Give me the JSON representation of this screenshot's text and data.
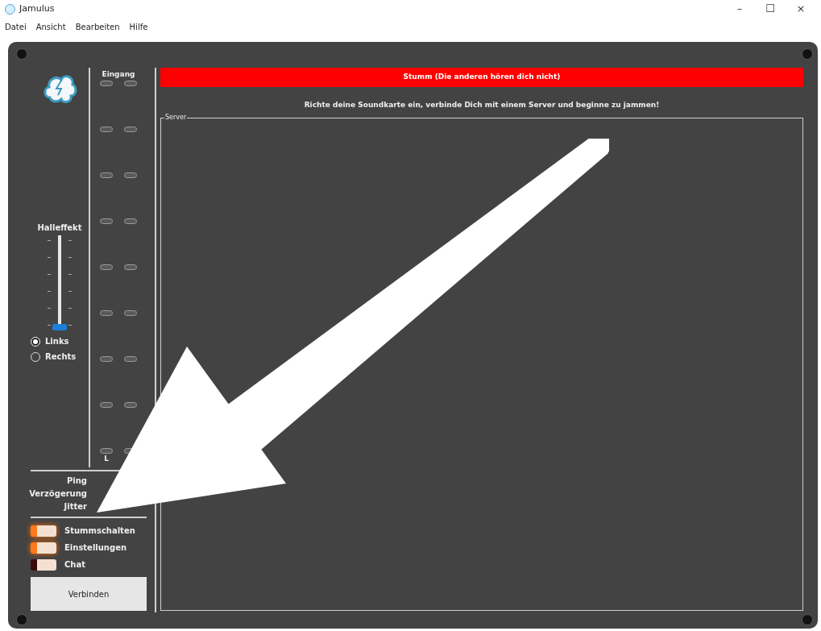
{
  "window": {
    "title": "Jamulus",
    "controls": [
      "–",
      "☐",
      "×"
    ]
  },
  "menu": [
    "Datei",
    "Ansicht",
    "Bearbeiten",
    "Hilfe"
  ],
  "reverb": {
    "label": "Halleffekt",
    "level": 0,
    "channels": [
      {
        "label": "Links",
        "selected": true
      },
      {
        "label": "Rechts",
        "selected": false
      }
    ]
  },
  "input_meter": {
    "title": "Eingang",
    "channel_label": "L"
  },
  "stats": [
    {
      "label": "Ping"
    },
    {
      "label": "Verzögerung"
    },
    {
      "label": "Jitter"
    }
  ],
  "toggles": [
    {
      "label": "Stummschalten",
      "on": true
    },
    {
      "label": "Einstellungen",
      "on": true
    },
    {
      "label": "Chat",
      "on": false
    }
  ],
  "connect_button": "Verbinden",
  "mute_banner": {
    "text": "Stumm (Die anderen hören dich nicht)",
    "on": true
  },
  "hint": "Richte deine Soundkarte ein, verbinde Dich mit einem Server und beginne zu jammen!",
  "server_group": {
    "title": "Server"
  }
}
